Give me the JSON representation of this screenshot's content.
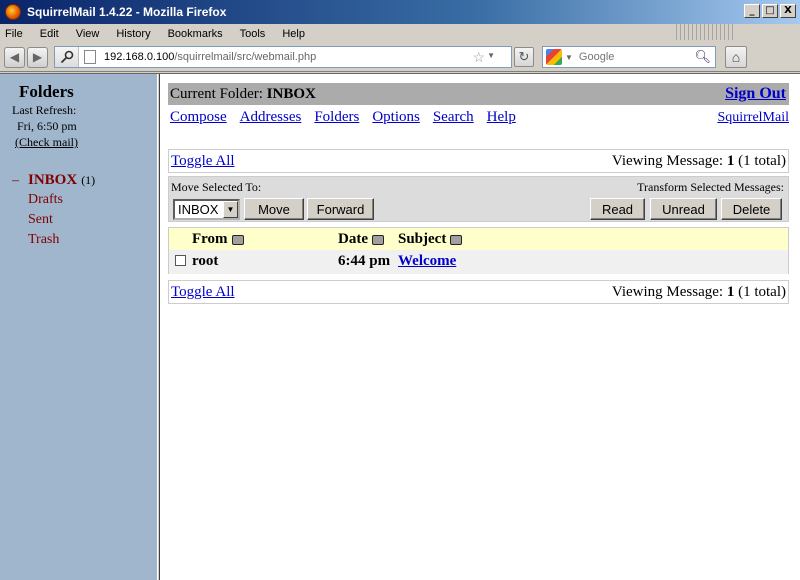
{
  "window": {
    "title": "SquirrelMail 1.4.22 - Mozilla Firefox",
    "controls": {
      "minimize": "_",
      "maximize": "□",
      "close": "X"
    }
  },
  "menubar": {
    "items": [
      {
        "label": "File"
      },
      {
        "label": "Edit"
      },
      {
        "label": "View"
      },
      {
        "label": "History"
      },
      {
        "label": "Bookmarks"
      },
      {
        "label": "Tools"
      },
      {
        "label": "Help"
      }
    ]
  },
  "navbar": {
    "url_host": "192.168.0.100",
    "url_path": "/squirrelmail/src/webmail.php",
    "search_placeholder": "Google"
  },
  "left": {
    "title": "Folders",
    "last_refresh_label": "Last Refresh:",
    "last_refresh_time": "Fri, 6:50 pm",
    "check_mail": "(Check mail)",
    "folders": [
      {
        "name": "INBOX",
        "count": "(1)",
        "marker": "–"
      },
      {
        "name": "Drafts"
      },
      {
        "name": "Sent"
      },
      {
        "name": "Trash"
      }
    ]
  },
  "main": {
    "current_folder_label": "Current Folder:",
    "current_folder": "INBOX",
    "sign_out": "Sign Out",
    "nav": {
      "compose": "Compose",
      "addresses": "Addresses",
      "folders": "Folders",
      "options": "Options",
      "search": "Search",
      "help": "Help",
      "squirrelmail": "SquirrelMail"
    },
    "toggle_all": "Toggle All",
    "viewing_label": "Viewing Message:",
    "viewing_num": "1",
    "viewing_total": "(1 total)",
    "move_selected_to": "Move Selected To:",
    "transform_selected": "Transform Selected Messages:",
    "move_select_value": "INBOX",
    "buttons": {
      "move": "Move",
      "forward": "Forward",
      "read": "Read",
      "unread": "Unread",
      "delete": "Delete"
    },
    "columns": {
      "from": "From",
      "date": "Date",
      "subject": "Subject"
    },
    "messages": [
      {
        "from": "root",
        "date": "6:44 pm",
        "subject": "Welcome"
      }
    ]
  },
  "colors": {
    "left_frame_bg": "#9fb6cd",
    "folder_color": "#800000",
    "link_color": "#0000cc",
    "header_row_bg": "#ffffcc"
  }
}
